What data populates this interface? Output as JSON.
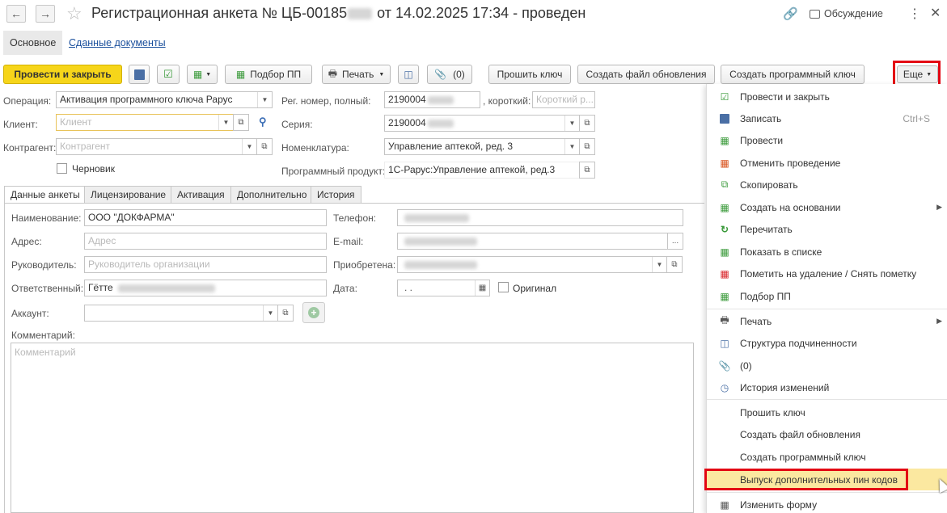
{
  "window": {
    "title_prefix": "Регистрационная анкета № ЦБ-00185",
    "title_suffix": " от 14.02.2025 17:34 - проведен",
    "discussion_label": "Обсуждение"
  },
  "tabs": [
    {
      "label": "Основное",
      "active": true
    },
    {
      "label": "Сданные документы",
      "active": false
    }
  ],
  "toolbar": {
    "post_close": "Провести и закрыть",
    "pick_pp": "Подбор ПП",
    "print": "Печать",
    "attachments": "(0)",
    "flash_key": "Прошить ключ",
    "create_update": "Создать файл обновления",
    "create_key": "Создать программный ключ",
    "more": "Еще"
  },
  "form": {
    "operation_label": "Операция:",
    "operation_value": "Активация программного ключа Рарус",
    "client_label": "Клиент:",
    "client_placeholder": "Клиент",
    "contractor_label": "Контрагент:",
    "contractor_placeholder": "Контрагент",
    "draft_label": "Черновик",
    "regnum_label": "Рег. номер, полный:",
    "regnum_value": "2190004",
    "short_label": ", короткий:",
    "short_placeholder": "Короткий р...",
    "series_label": "Серия:",
    "series_value": "2190004",
    "nomenclature_label": "Номенклатура:",
    "nomenclature_value": "Управление аптекой, ред. 3",
    "product_label": "Программный продукт:",
    "product_value": "1С-Рарус:Управление аптекой, ред.3"
  },
  "form_tabs": [
    "Данные анкеты",
    "Лицензирование",
    "Активация",
    "Дополнительно",
    "История"
  ],
  "details": {
    "name_label": "Наименование:",
    "name_value": "ООО \"ДОКФАРМА\"",
    "address_label": "Адрес:",
    "address_placeholder": "Адрес",
    "head_label": "Руководитель:",
    "head_placeholder": "Руководитель организации",
    "responsible_label": "Ответственный:",
    "responsible_value": "Гётте",
    "account_label": "Аккаунт:",
    "phone_label": "Телефон:",
    "email_label": "E-mail:",
    "acquired_label": "Приобретена:",
    "date_label": "Дата:",
    "date_value": ". .",
    "original_label": "Оригинал",
    "comment_label": "Комментарий:",
    "comment_placeholder": "Комментарий"
  },
  "menu": {
    "items": [
      {
        "label": "Провести и закрыть",
        "icon": "post-close-icon"
      },
      {
        "label": "Записать",
        "icon": "save-icon",
        "shortcut": "Ctrl+S"
      },
      {
        "label": "Провести",
        "icon": "post-icon"
      },
      {
        "label": "Отменить проведение",
        "icon": "unpost-icon"
      },
      {
        "label": "Скопировать",
        "icon": "copy-icon"
      },
      {
        "label": "Создать на основании",
        "icon": "create-based-icon"
      },
      {
        "label": "Перечитать",
        "icon": "reload-icon"
      },
      {
        "label": "Показать в списке",
        "icon": "show-in-list-icon"
      },
      {
        "label": "Пометить на удаление / Снять пометку",
        "icon": "delete-mark-icon"
      },
      {
        "label": "Подбор ПП",
        "icon": "pick-pp-icon"
      },
      {
        "label": "Печать",
        "icon": "print-icon"
      },
      {
        "label": "Структура подчиненности",
        "icon": "structure-icon"
      },
      {
        "label": "(0)",
        "icon": "paperclip-icon"
      },
      {
        "label": "История изменений",
        "icon": "history-icon"
      },
      {
        "label": "Прошить ключ"
      },
      {
        "label": "Создать файл обновления"
      },
      {
        "label": "Создать программный ключ"
      },
      {
        "label": "Выпуск дополнительных пин кодов"
      },
      {
        "label": "Изменить форму",
        "icon": "edit-form-icon"
      }
    ]
  },
  "colors": {
    "accent_yellow": "#f6d51a",
    "highlight_red": "#e30613",
    "link_blue": "#1a4f9c",
    "menu_highlight": "#fbe8a0"
  }
}
